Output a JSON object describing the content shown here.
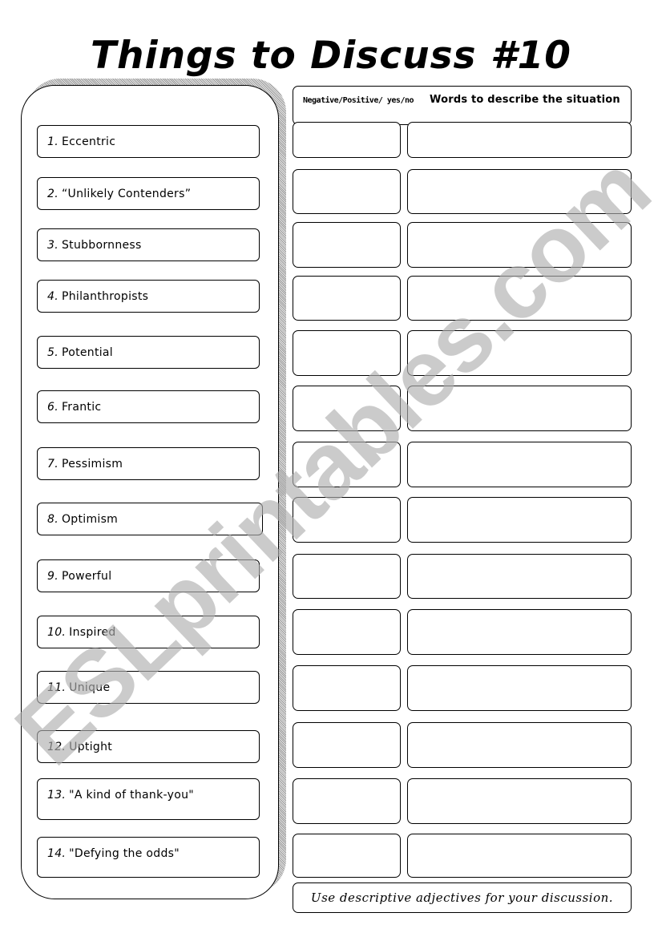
{
  "title": "Things to Discuss #10",
  "table_header": {
    "column_1": "Negative/Positive/ yes/no",
    "column_2": "Words to describe the situation"
  },
  "items": [
    {
      "number": "1.",
      "text": "Eccentric"
    },
    {
      "number": "2.",
      "text": "“Unlikely Contenders”"
    },
    {
      "number": "3.",
      "text": "Stubbornness"
    },
    {
      "number": "4.",
      "text": "Philanthropists"
    },
    {
      "number": "5.",
      "text": "Potential"
    },
    {
      "number": "6.",
      "text": "Frantic"
    },
    {
      "number": "7.",
      "text": "Pessimism"
    },
    {
      "number": "8.",
      "text": "Optimism"
    },
    {
      "number": "9.",
      "text": "Powerful"
    },
    {
      "number": "10.",
      "text": "Inspired"
    },
    {
      "number": "11.",
      "text": "Unique"
    },
    {
      "number": "12.",
      "text": " Uptight"
    },
    {
      "number": "13.",
      "text": "\"A kind of thank-you\""
    },
    {
      "number": "14.",
      "text": " \"Defying the odds\""
    }
  ],
  "footer_note": "Use descriptive adjectives for your discussion.",
  "watermark": "ESLprintables.com"
}
